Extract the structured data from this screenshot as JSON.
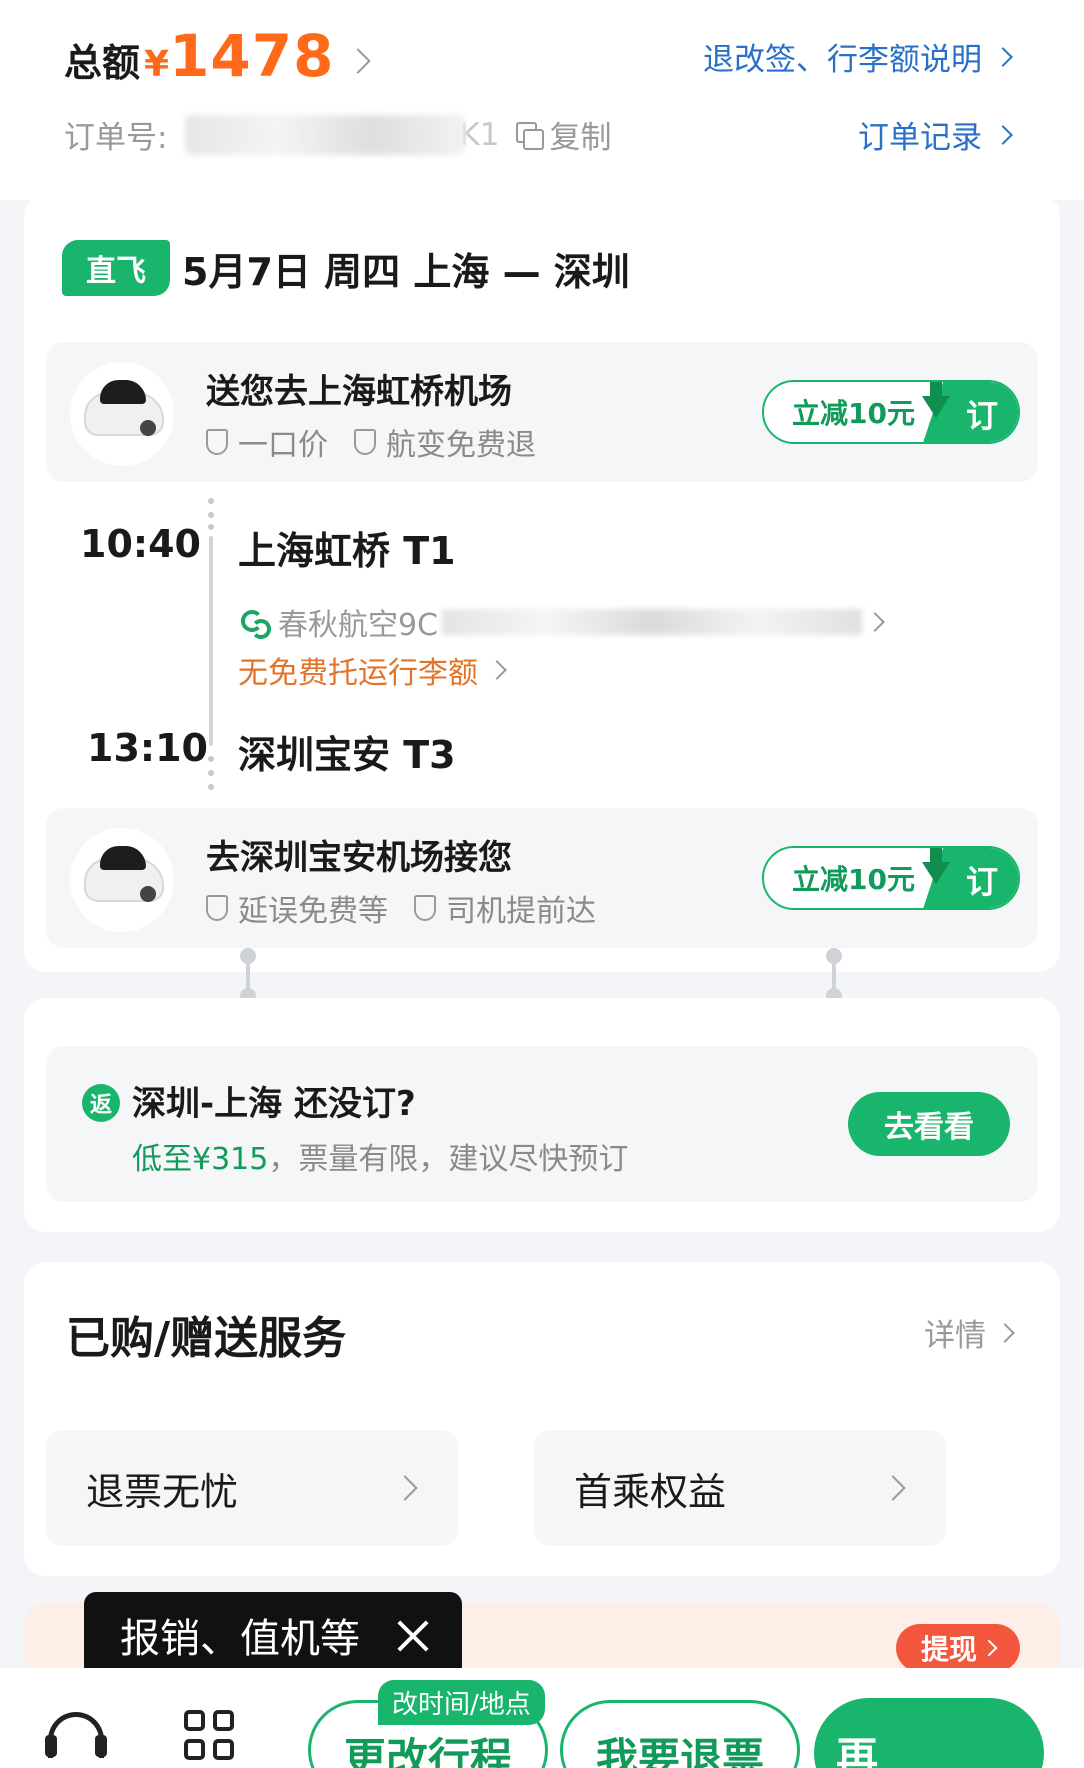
{
  "header": {
    "total_label": "总额",
    "currency": "¥",
    "total_amount": "1478",
    "rules_link": "退改签、行李额说明",
    "order_label": "订单号:",
    "order_tail": "K1",
    "copy_label": "复制",
    "order_history_link": "订单记录"
  },
  "flight": {
    "tag": "直飞",
    "info": "5月7日 周四 上海 — 深圳",
    "departure": {
      "time": "10:40",
      "airport": "上海虹桥 T1"
    },
    "arrival": {
      "time": "13:10",
      "airport": "深圳宝安 T3"
    },
    "airline": "春秋航空9C",
    "baggage_notice": "无免费托运行李额"
  },
  "transfers": [
    {
      "title": "送您去上海虹桥机场",
      "features": [
        "一口价",
        "航变免费退"
      ],
      "discount": "立减10元",
      "action": "订"
    },
    {
      "title": "去深圳宝安机场接您",
      "features": [
        "延误免费等",
        "司机提前达"
      ],
      "discount": "立减10元",
      "action": "订"
    }
  ],
  "return_trip": {
    "badge": "返",
    "title": "深圳-上海 还没订?",
    "price": "低至¥315",
    "note": "，票量有限，建议尽快预订",
    "button": "去看看"
  },
  "services": {
    "title": "已购/赠送服务",
    "detail_link": "详情",
    "items": [
      "退票无忧",
      "首乘权益"
    ]
  },
  "promo": {
    "cash_button": "提现"
  },
  "tooltip": {
    "text": "报销、值机等"
  },
  "bottom_bar": {
    "change_tag": "改时间/地点",
    "change_button": "更改行程",
    "refund_button": "我要退票",
    "rebook_button": "再"
  },
  "colors": {
    "brand_green": "#19b56c",
    "price_orange": "#ff6a1a",
    "link_blue": "#2a70c8"
  }
}
